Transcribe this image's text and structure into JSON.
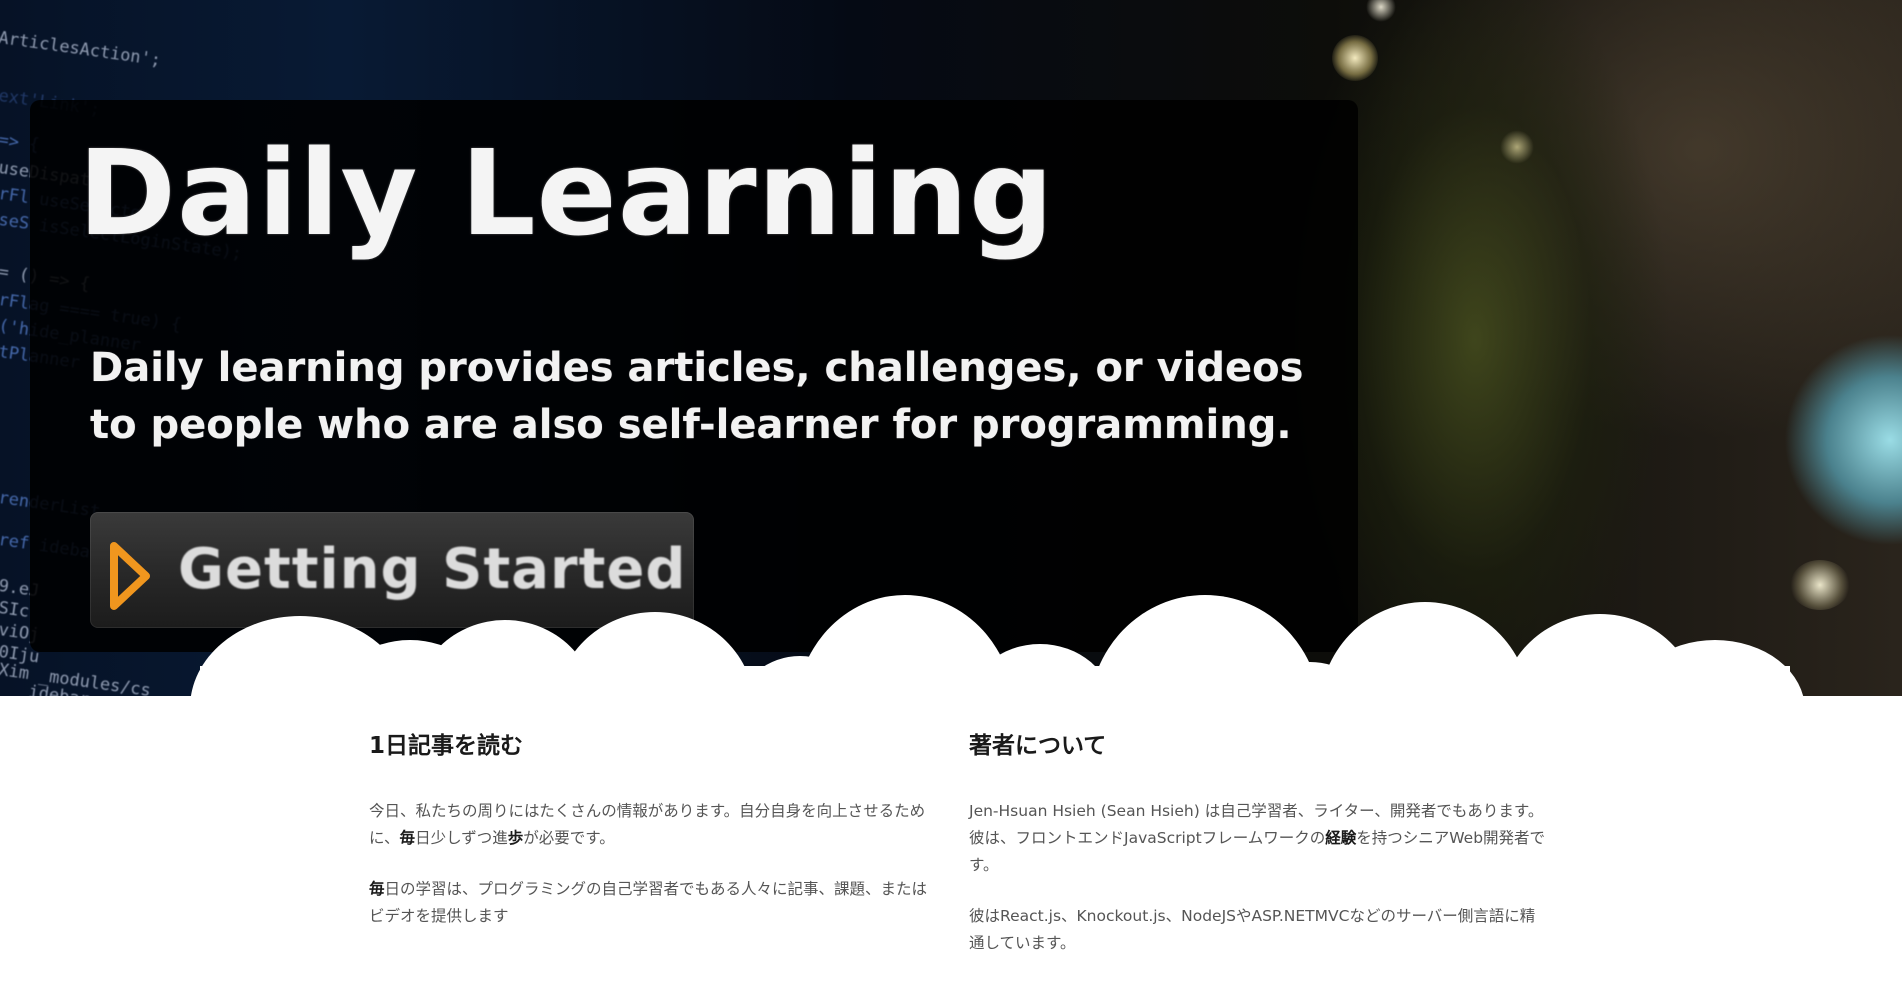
{
  "hero": {
    "title": "Daily Learning",
    "description": "Daily learning provides articles, challenges, or videos to people who are also self-learner for programming.",
    "cta_label": "Getting Started",
    "code_lines": [
      "ArticlesAction';",
      "ext'Link';",
      "=> {",
      "  useDispatch",
      "rFl  useSelector",
      "seS  isSelectLoginState);",
      "= () => {",
      "rFlag ==== true) {",
      "('hide_planner",
      "tPlanner",
      "renderList",
      "ref  idebar",
      "9.eJ",
      "SIc",
      "viOj",
      "0Iju",
      "Xim  _modules/cs",
      "  idebar.c"
    ],
    "colors": {
      "accent_icon": "#f0961e",
      "panel": "#000000",
      "title": "#f4f4f4"
    }
  },
  "sections": {
    "read": {
      "heading": "1日記事を読む",
      "p1_a": "今日、私たちの周りにはたくさんの情報があります。自分自身を向上させるために、",
      "p1_b": "毎",
      "p1_c": "日少しずつ進",
      "p1_d": "歩",
      "p1_e": "が必要です。",
      "p2_a": "毎",
      "p2_b": "日の学習は、プログラミングの自己学習者でもある人々に記事、課題、またはビデオを提供します"
    },
    "author": {
      "heading": "著者について",
      "p1_a": "Jen-Hsuan Hsieh (Sean Hsieh) は自己学習者、ライター、開発者でもあります。彼は、フロントエンドJavaScriptフレームワークの",
      "p1_b": "経験",
      "p1_c": "を持つシニアWeb開発者です。",
      "p2": "彼はReact.js、Knockout.js、NodeJSやASP.NETMVCなどのサーバー側言語に精通しています。"
    }
  }
}
